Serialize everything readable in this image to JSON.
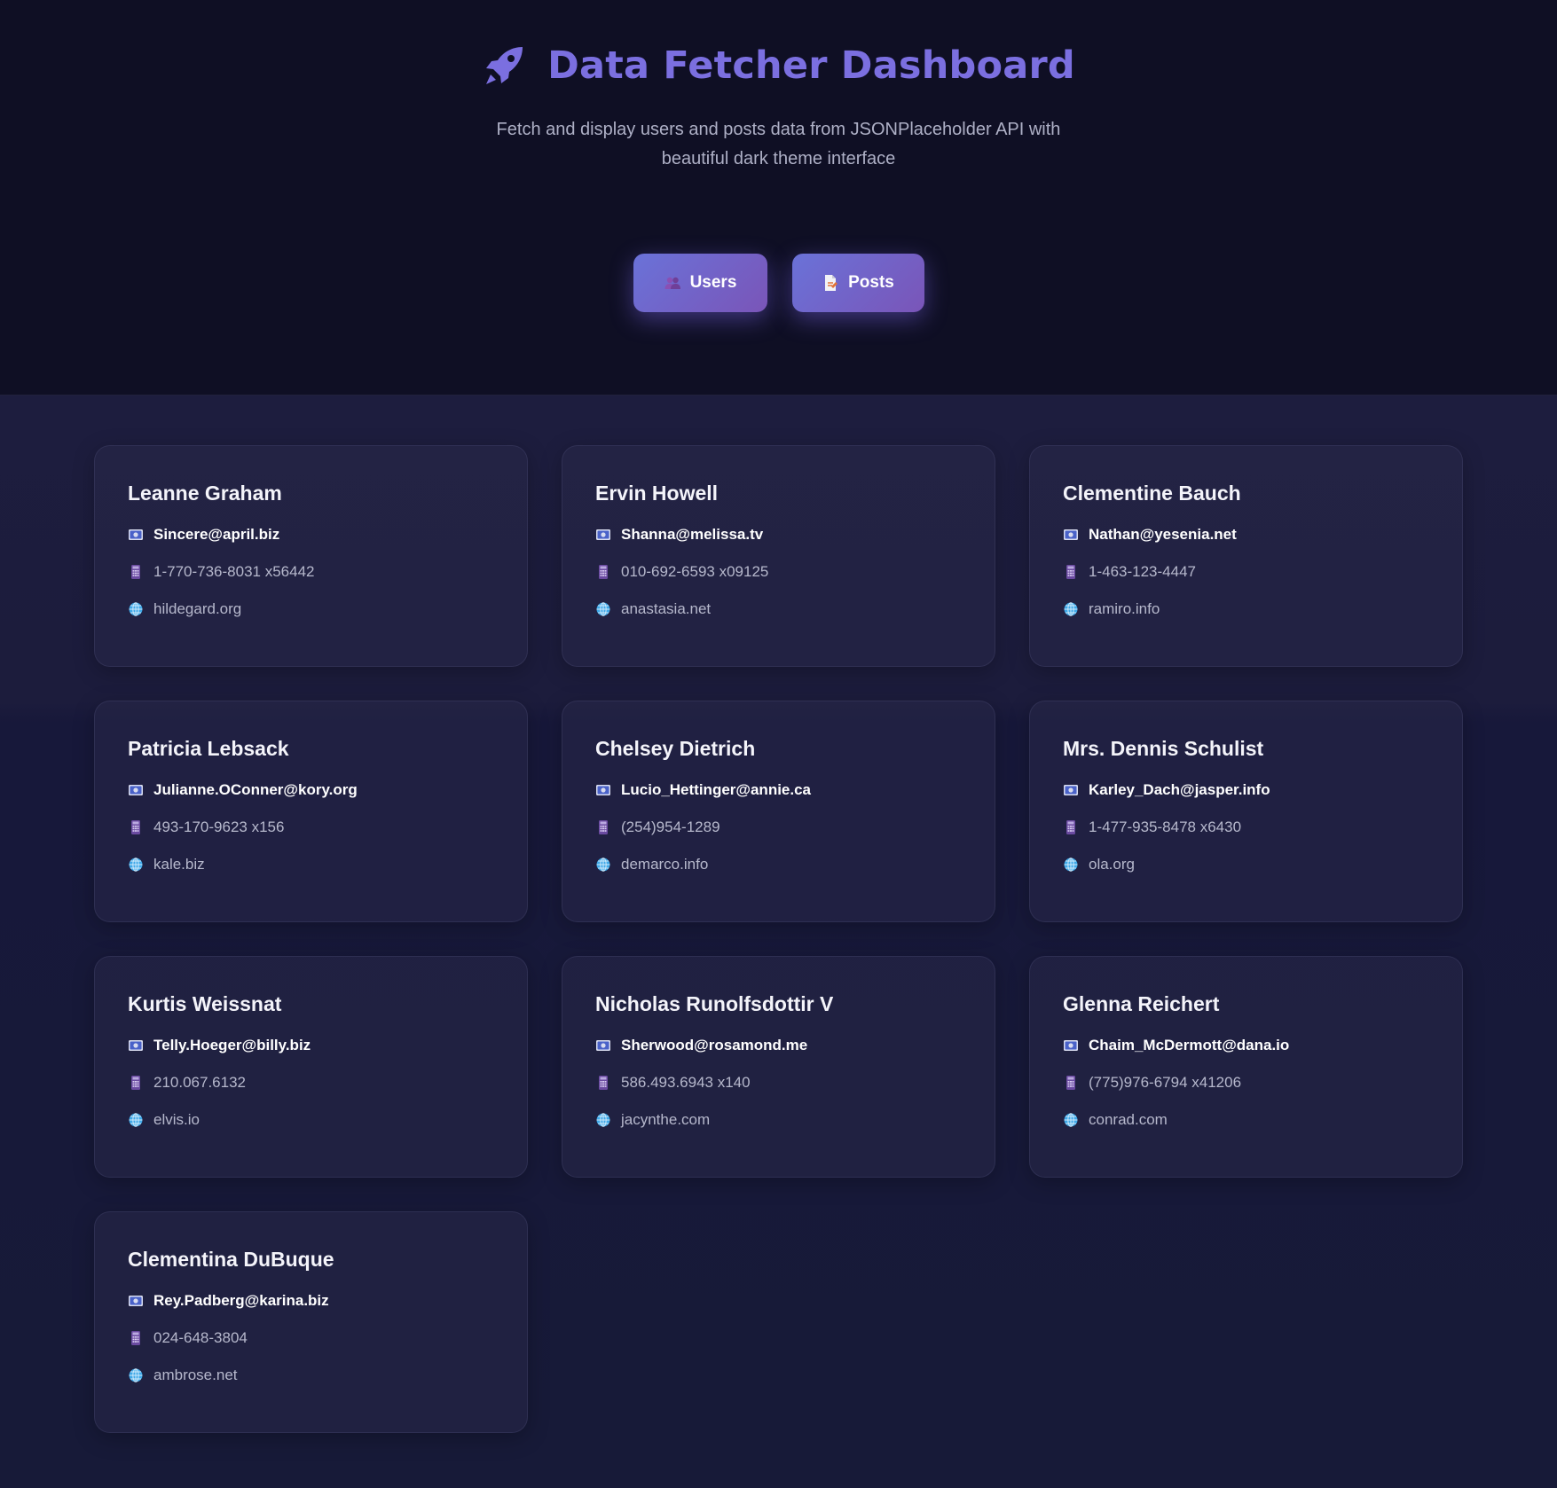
{
  "header": {
    "title": "Data Fetcher Dashboard",
    "subtitle": "Fetch and display users and posts data from JSONPlaceholder API with beautiful dark theme interface",
    "icon": "rocket-icon",
    "accent": "#7b6fe0"
  },
  "nav": {
    "users_label": "Users",
    "posts_label": "Posts",
    "users_icon": "people-icon",
    "posts_icon": "document-icon"
  },
  "users": [
    {
      "name": "Leanne Graham",
      "email": "Sincere@april.biz",
      "phone": "1-770-736-8031 x56442",
      "website": "hildegard.org"
    },
    {
      "name": "Ervin Howell",
      "email": "Shanna@melissa.tv",
      "phone": "010-692-6593 x09125",
      "website": "anastasia.net"
    },
    {
      "name": "Clementine Bauch",
      "email": "Nathan@yesenia.net",
      "phone": "1-463-123-4447",
      "website": "ramiro.info"
    },
    {
      "name": "Patricia Lebsack",
      "email": "Julianne.OConner@kory.org",
      "phone": "493-170-9623 x156",
      "website": "kale.biz"
    },
    {
      "name": "Chelsey Dietrich",
      "email": "Lucio_Hettinger@annie.ca",
      "phone": "(254)954-1289",
      "website": "demarco.info"
    },
    {
      "name": "Mrs. Dennis Schulist",
      "email": "Karley_Dach@jasper.info",
      "phone": "1-477-935-8478 x6430",
      "website": "ola.org"
    },
    {
      "name": "Kurtis Weissnat",
      "email": "Telly.Hoeger@billy.biz",
      "phone": "210.067.6132",
      "website": "elvis.io"
    },
    {
      "name": "Nicholas Runolfsdottir V",
      "email": "Sherwood@rosamond.me",
      "phone": "586.493.6943 x140",
      "website": "jacynthe.com"
    },
    {
      "name": "Glenna Reichert",
      "email": "Chaim_McDermott@dana.io",
      "phone": "(775)976-6794 x41206",
      "website": "conrad.com"
    },
    {
      "name": "Clementina DuBuque",
      "email": "Rey.Padberg@karina.biz",
      "phone": "024-648-3804",
      "website": "ambrose.net"
    }
  ]
}
